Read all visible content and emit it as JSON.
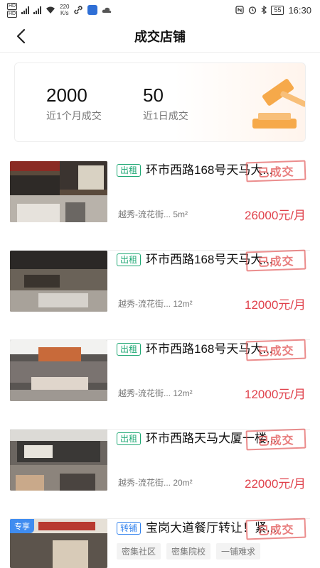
{
  "status_bar": {
    "speed": "220",
    "speed_unit": "K/s",
    "battery": "55",
    "time": "16:30"
  },
  "header": {
    "title": "成交店铺"
  },
  "stats": {
    "month_value": "2000",
    "month_label": "近1个月成交",
    "day_value": "50",
    "day_label": "近1日成交"
  },
  "listings": [
    {
      "type": "出租",
      "title": "环市西路168号天马大...",
      "stamp": "已成交",
      "meta": "越秀-流花街... 5m²",
      "price": "26000元/月"
    },
    {
      "type": "出租",
      "title": "环市西路168号天马大...",
      "stamp": "已成交",
      "meta": "越秀-流花街... 12m²",
      "price": "12000元/月"
    },
    {
      "type": "出租",
      "title": "环市西路168号天马大...",
      "stamp": "已成交",
      "meta": "越秀-流花街... 12m²",
      "price": "12000元/月"
    },
    {
      "type": "出租",
      "title": "环市西路天马大厦一楼...",
      "stamp": "已成交",
      "meta": "越秀-流花街... 20m²",
      "price": "22000元/月"
    },
    {
      "type": "转铺",
      "badge": "专享",
      "title": "宝岗大道餐厅转让！紧...",
      "stamp": "已成交",
      "chips": [
        "密集社区",
        "密集院校",
        "一铺难求"
      ]
    }
  ],
  "colors": {
    "price": "#e0414b",
    "rent_tag": "#1fa874",
    "transfer_tag": "#2f80ed",
    "promo_badge": "#3f8cf0",
    "gavel": "#f6a94a"
  }
}
